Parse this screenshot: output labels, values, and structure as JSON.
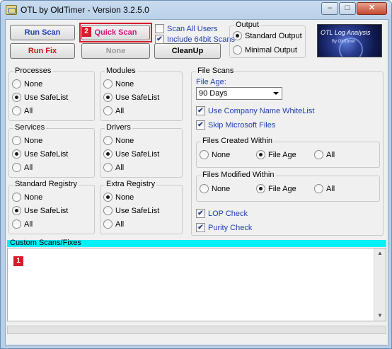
{
  "window": {
    "title": "OTL by OldTimer - Version 3.2.5.0"
  },
  "titlebar": {
    "minimize": "–",
    "maximize": "□",
    "close": "✕"
  },
  "toolbar": {
    "run_scan": "Run Scan",
    "quick_scan": "Quick Scan",
    "run_fix": "Run Fix",
    "none": "None",
    "cleanup": "CleanUp",
    "scan_all_users": "Scan All Users",
    "include_64bit": "Include 64bit Scans",
    "quick_scan_badge": "2"
  },
  "output": {
    "label": "Output",
    "standard": "Standard Output",
    "minimal": "Minimal Output",
    "selected": "Standard Output"
  },
  "logo": {
    "title": "OTL Log Analysis",
    "subtitle": "By OldTimer"
  },
  "groups": {
    "processes": {
      "label": "Processes",
      "options": [
        "None",
        "Use SafeList",
        "All"
      ],
      "selected": "Use SafeList"
    },
    "modules": {
      "label": "Modules",
      "options": [
        "None",
        "Use SafeList",
        "All"
      ],
      "selected": "Use SafeList"
    },
    "services": {
      "label": "Services",
      "options": [
        "None",
        "Use SafeList",
        "All"
      ],
      "selected": "Use SafeList"
    },
    "drivers": {
      "label": "Drivers",
      "options": [
        "None",
        "Use SafeList",
        "All"
      ],
      "selected": "Use SafeList"
    },
    "standard_registry": {
      "label": "Standard Registry",
      "options": [
        "None",
        "Use SafeList",
        "All"
      ],
      "selected": "Use SafeList"
    },
    "extra_registry": {
      "label": "Extra Registry",
      "options": [
        "None",
        "Use SafeList",
        "All"
      ],
      "selected": "None"
    }
  },
  "file_scans": {
    "label": "File Scans",
    "file_age_label": "File Age:",
    "file_age_value": "90 Days",
    "company_whitelist": "Use Company Name WhiteList",
    "skip_microsoft": "Skip Microsoft Files",
    "created_within": {
      "label": "Files Created Within",
      "options": [
        "None",
        "File Age",
        "All"
      ],
      "selected": "File Age"
    },
    "modified_within": {
      "label": "Files Modified Within",
      "options": [
        "None",
        "File Age",
        "All"
      ],
      "selected": "File Age"
    },
    "lop_check": "LOP Check",
    "purity_check": "Purity Check"
  },
  "custom": {
    "label": "Custom Scans/Fixes",
    "badge": "1"
  },
  "colors": {
    "accent_cyan": "#00f0f5",
    "annotation_red": "#d51d2a"
  }
}
